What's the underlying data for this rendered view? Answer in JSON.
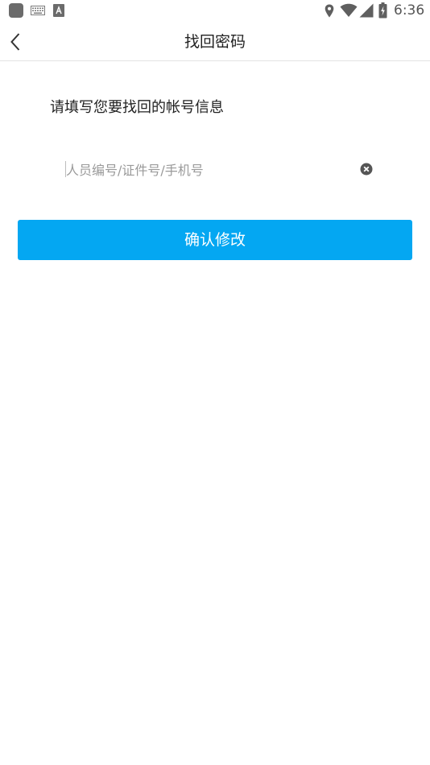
{
  "status_bar": {
    "time": "6:36",
    "icons": [
      "app-icon",
      "keyboard-icon",
      "a-icon",
      "location-icon",
      "wifi-icon",
      "signal-icon",
      "battery-icon"
    ]
  },
  "header": {
    "title": "找回密码",
    "back_icon": "chevron-left-icon"
  },
  "form": {
    "instruction": "请填写您要找回的帐号信息",
    "account_input": {
      "value": "",
      "placeholder": "人员编号/证件号/手机号"
    },
    "clear_icon": "clear-circle-icon",
    "submit_label": "确认修改"
  },
  "colors": {
    "accent": "#04a7f2",
    "background": "#ffffff",
    "placeholder": "#9a9a9a"
  }
}
